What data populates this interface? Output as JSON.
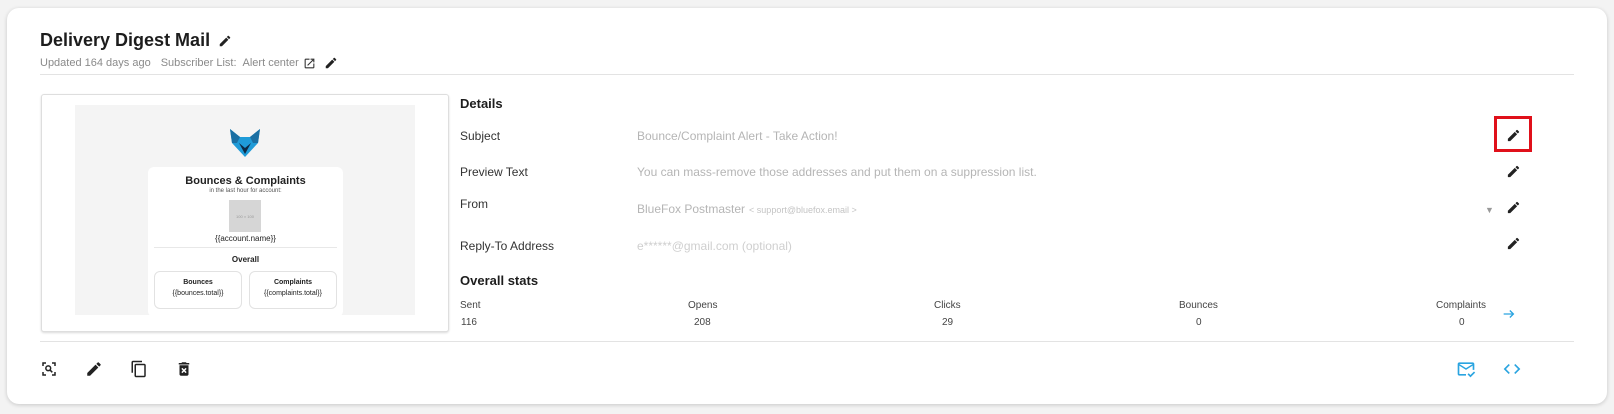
{
  "header": {
    "title": "Delivery Digest Mail",
    "updated": "Updated 164 days ago",
    "subscriber_label": "Subscriber List:",
    "subscriber_value": "Alert center"
  },
  "preview": {
    "heading": "Bounces & Complaints",
    "subheading": "in the last hour for account:",
    "image_placeholder": "100 × 100",
    "account_var": "{{account.name}}",
    "overall_label": "Overall",
    "boxes": [
      {
        "label": "Bounces",
        "value": "{{bounces.total}}"
      },
      {
        "label": "Complaints",
        "value": "{{complaints.total}}"
      }
    ]
  },
  "details": {
    "heading": "Details",
    "subject": {
      "label": "Subject",
      "value": "Bounce/Complaint Alert - Take Action!"
    },
    "preview_text": {
      "label": "Preview Text",
      "value": "You can mass-remove those addresses and put them on a suppression list."
    },
    "from": {
      "label": "From",
      "name": "BlueFox Postmaster",
      "email": "< support@bluefox.email >"
    },
    "reply_to": {
      "label": "Reply-To Address",
      "value": "e******@gmail.com (optional)"
    }
  },
  "stats": {
    "heading": "Overall stats",
    "items": [
      {
        "label": "Sent",
        "value": "116"
      },
      {
        "label": "Opens",
        "value": "208"
      },
      {
        "label": "Clicks",
        "value": "29"
      },
      {
        "label": "Bounces",
        "value": "0"
      },
      {
        "label": "Complaints",
        "value": "0"
      }
    ]
  },
  "colors": {
    "accent": "#2aa4e0",
    "highlight": "#e0101a",
    "logo": "#1f9bd8"
  },
  "icons": {
    "title_edit": "pencil-icon",
    "external_link": "open-in-new-icon",
    "subscriber_edit": "pencil-icon",
    "stats_arrow": "arrow-right-icon",
    "bottom": [
      "search-preview-icon",
      "pencil-icon",
      "copy-icon",
      "delete-icon",
      "mail-check-icon",
      "code-icon"
    ]
  }
}
